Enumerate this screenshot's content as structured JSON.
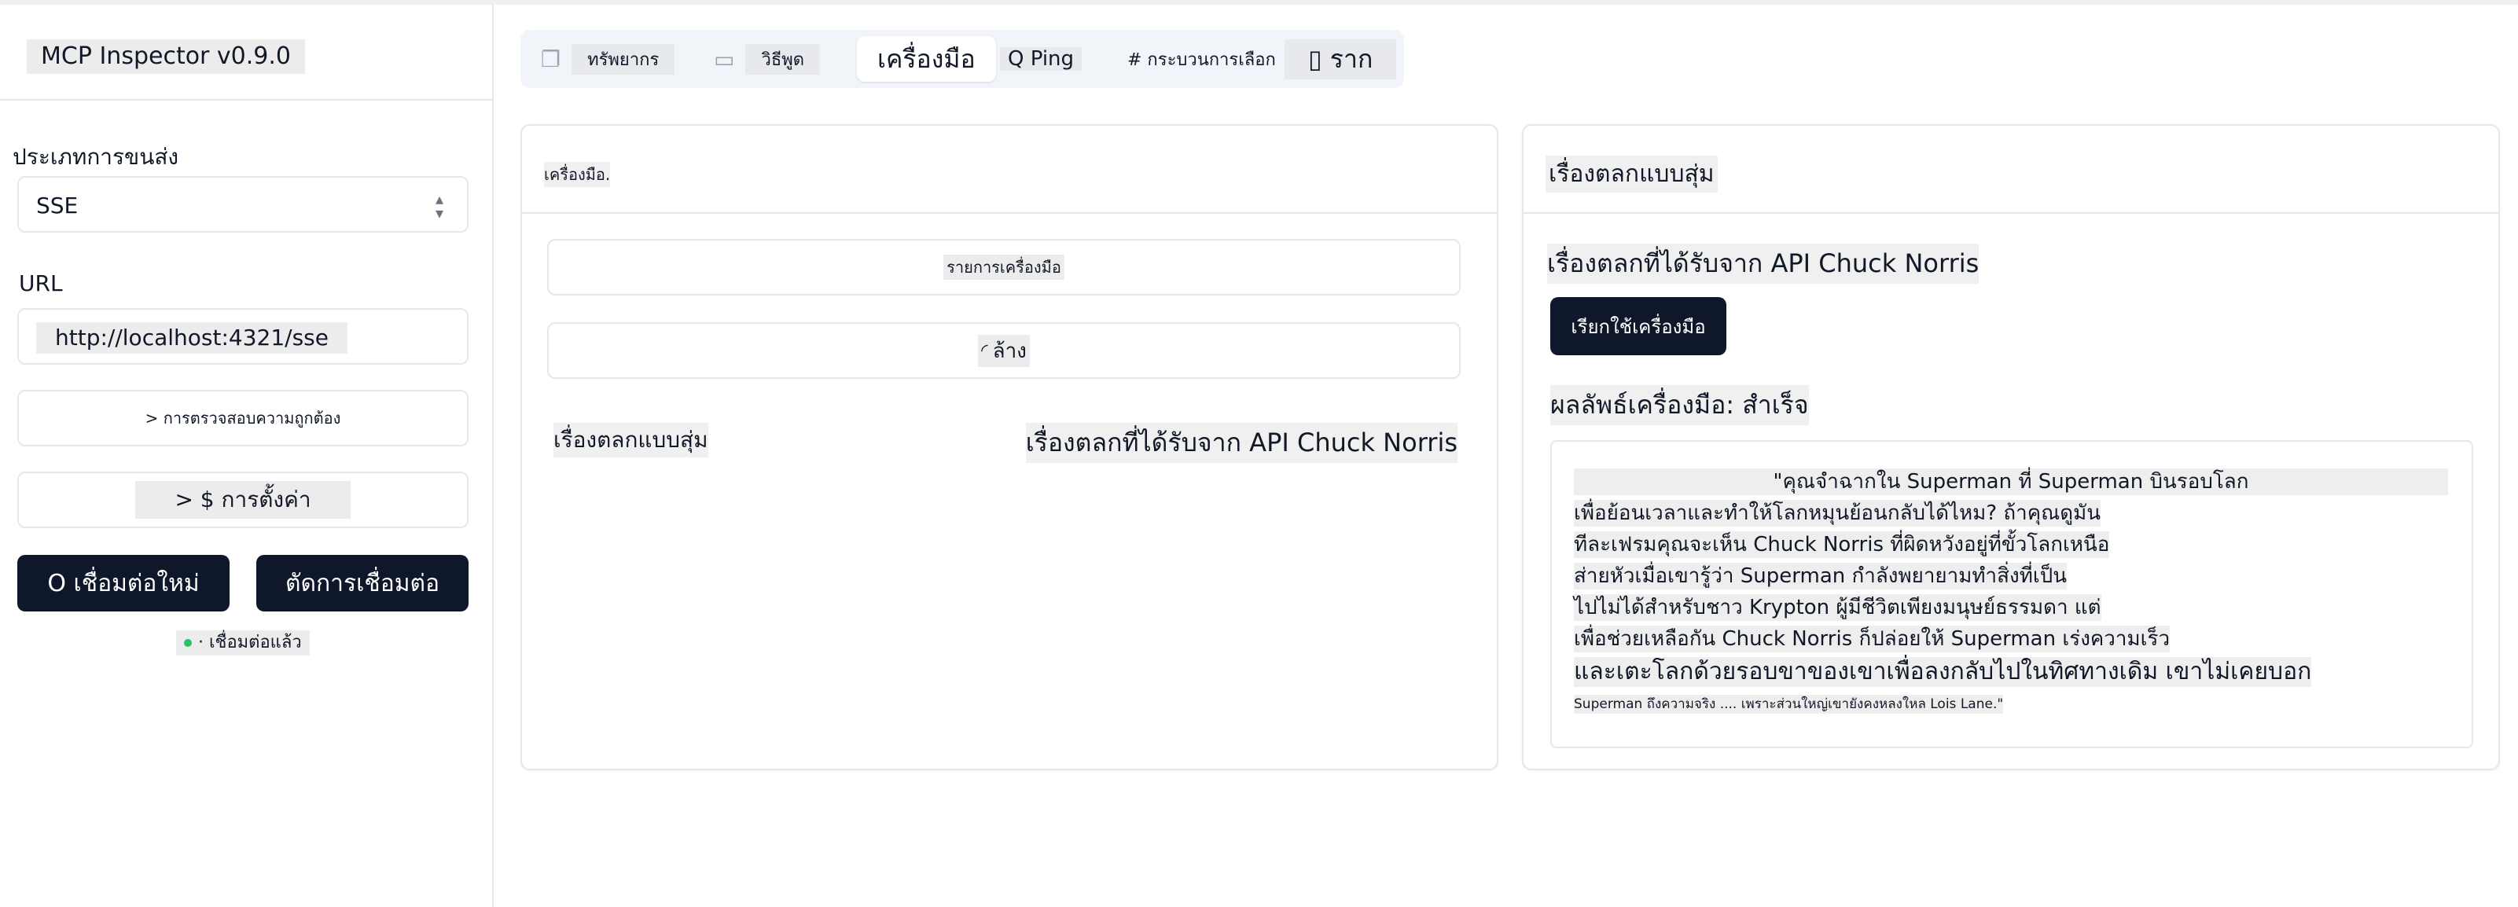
{
  "sidebar": {
    "app_title": "MCP Inspector v0.9.0",
    "transport_label": "ประเภทการขนส่ง",
    "transport_value": "SSE",
    "url_label": "URL",
    "url_value": "http://localhost:4321/sse",
    "auth_button": "> การตรวจสอบความถูกต้อง",
    "config_button": "> $ การตั้งค่า",
    "reconnect_button": "O เชื่อมต่อใหม่",
    "disconnect_button": "ตัดการเชื่อมต่อ",
    "status_text": "· เชื่อมต่อแล้ว",
    "status_color": "#22c55e"
  },
  "tabs": [
    {
      "label": "ทรัพยากร",
      "icon": "files-icon"
    },
    {
      "label": "วิธีพูด",
      "icon": "message-icon"
    },
    {
      "label": "เครื่องมือ",
      "icon": "tool-icon",
      "active": true
    },
    {
      "label": "Q Ping",
      "icon": ""
    },
    {
      "label": "# กระบวนการเลือก",
      "icon": ""
    },
    {
      "label": "▯ ราก",
      "icon": ""
    }
  ],
  "tools_panel": {
    "title": "เครื่องมือ.",
    "list_button": "รายการเครื่องมือ",
    "clear_button": "ล้าง",
    "tool_name": "เรื่องตลกแบบสุ่ม",
    "tool_description": "เรื่องตลกที่ได้รับจาก API Chuck Norris"
  },
  "detail_panel": {
    "title": "เรื่องตลกแบบสุ่ม",
    "subtitle": "เรื่องตลกที่ได้รับจาก API Chuck Norris",
    "run_button": "เรียกใช้เครื่องมือ",
    "result_label": "ผลลัพธ์เครื่องมือ: สำเร็จ",
    "result_lines": [
      "\"คุณจำฉากใน Superman ที่ Superman บินรอบโลก",
      "เพื่อย้อนเวลาและทำให้โลกหมุนย้อนกลับได้ไหม? ถ้าคุณดูมัน",
      "ทีละเฟรมคุณจะเห็น Chuck Norris ที่ผิดหวังอยู่ที่ขั้วโลกเหนือ",
      "ส่ายหัวเมื่อเขารู้ว่า Superman กำลังพยายามทำสิ่งที่เป็น",
      "ไปไม่ได้สำหรับชาว Krypton ผู้มีชีวิตเพียงมนุษย์ธรรมดา แต่",
      "เพื่อช่วยเหลือกัน Chuck Norris ก็ปล่อยให้ Superman เร่งความเร็ว",
      "และเตะโลกด้วยรอบขาของเขาเพื่อลงกลับไปในทิศทางเดิม เขาไม่เคยบอก",
      "Superman ถึงความจริง .... เพราะส่วนใหญ่เขายังคงหลงใหล Lois Lane.\""
    ]
  },
  "colors": {
    "primary": "#0f172a",
    "border": "#e5e7eb",
    "tabbar_bg": "#f1f5f9"
  }
}
